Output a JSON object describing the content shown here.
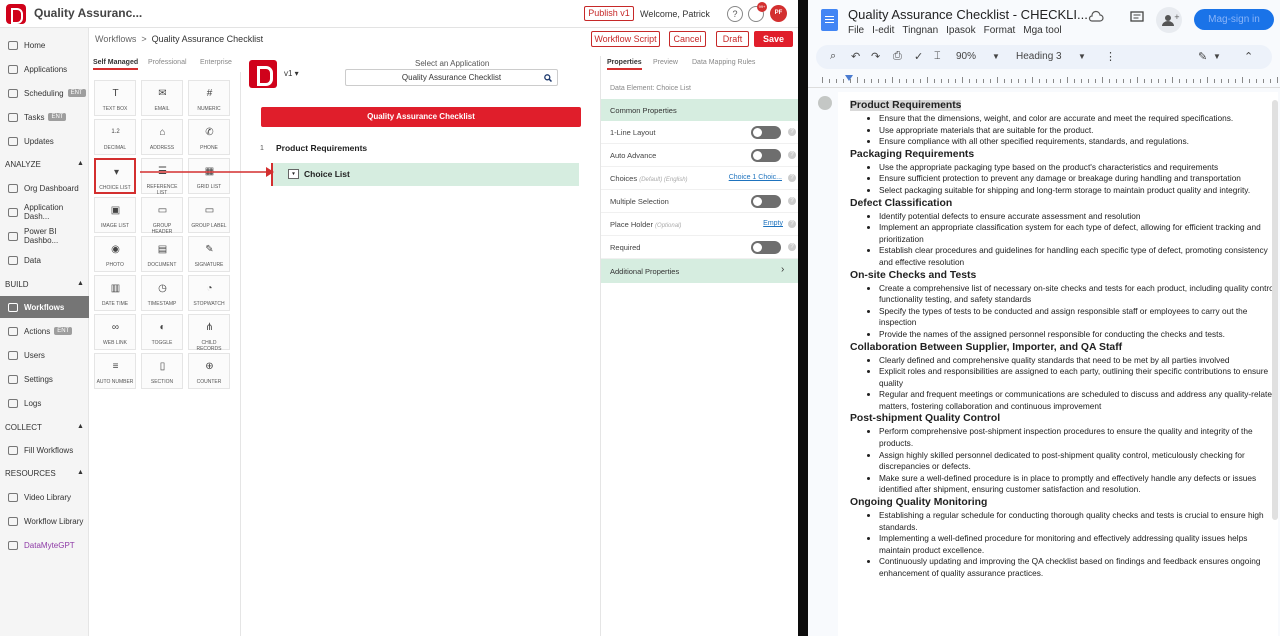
{
  "left": {
    "app_title": "Quality Assuranc...",
    "publish_label": "Publish v1",
    "welcome": "Welcome, Patrick",
    "help_icon": "?",
    "notif_count": "99+",
    "avatar_initials": "PF",
    "breadcrumb": {
      "root": "Workflows",
      "sep": ">",
      "current": "Quality Assurance Checklist"
    },
    "buttons": {
      "workflow_script": "Workflow Script",
      "cancel": "Cancel",
      "draft": "Draft",
      "save": "Save"
    },
    "accent_color": "#d32f2f",
    "sidebar": {
      "items": [
        {
          "label": "Home"
        },
        {
          "label": "Applications"
        },
        {
          "label": "Scheduling",
          "badge": "ENT"
        },
        {
          "label": "Tasks",
          "badge": "ENT"
        },
        {
          "label": "Updates"
        }
      ],
      "analyze_head": "ANALYZE",
      "analyze_items": [
        {
          "label": "Org Dashboard"
        },
        {
          "label": "Application Dash..."
        },
        {
          "label": "Power BI Dashbo..."
        },
        {
          "label": "Data"
        }
      ],
      "build_head": "BUILD",
      "build_items": [
        {
          "label": "Workflows"
        },
        {
          "label": "Actions",
          "badge": "ENT"
        },
        {
          "label": "Users"
        },
        {
          "label": "Settings"
        },
        {
          "label": "Logs"
        }
      ],
      "collect_head": "COLLECT",
      "collect_items": [
        {
          "label": "Fill Workflows"
        }
      ],
      "resources_head": "RESOURCES",
      "resources_items": [
        {
          "label": "Video Library"
        },
        {
          "label": "Workflow Library"
        },
        {
          "label": "DataMyteGPT"
        }
      ]
    },
    "palette_tabs": [
      "Self Managed",
      "Professional",
      "Enterprise"
    ],
    "palette": [
      {
        "label": "TEXT BOX",
        "icon": "T"
      },
      {
        "label": "EMAIL",
        "icon": "✉"
      },
      {
        "label": "NUMERIC",
        "icon": "#"
      },
      {
        "label": "DECIMAL",
        "icon": "1.2"
      },
      {
        "label": "ADDRESS",
        "icon": "⌂"
      },
      {
        "label": "PHONE",
        "icon": "✆"
      },
      {
        "label": "CHOICE LIST",
        "icon": "▾"
      },
      {
        "label": "REFERENCE LIST",
        "icon": "☰"
      },
      {
        "label": "GRID LIST",
        "icon": "▦"
      },
      {
        "label": "IMAGE LIST",
        "icon": "▣"
      },
      {
        "label": "GROUP HEADER",
        "icon": "▭"
      },
      {
        "label": "GROUP LABEL",
        "icon": "▭"
      },
      {
        "label": "PHOTO",
        "icon": "◉"
      },
      {
        "label": "DOCUMENT",
        "icon": "▤"
      },
      {
        "label": "SIGNATURE",
        "icon": "✎"
      },
      {
        "label": "DATE TIME",
        "icon": "▥"
      },
      {
        "label": "TIMESTAMP",
        "icon": "◷"
      },
      {
        "label": "STOPWATCH",
        "icon": "◔"
      },
      {
        "label": "WEB LINK",
        "icon": "∞"
      },
      {
        "label": "TOGGLE",
        "icon": "◐"
      },
      {
        "label": "CHILD RECORDS",
        "icon": "⋔"
      },
      {
        "label": "AUTO NUMBER",
        "icon": "≡"
      },
      {
        "label": "SECTION",
        "icon": "▯"
      },
      {
        "label": "COUNTER",
        "icon": "⊕"
      }
    ],
    "canvas": {
      "version": "v1 ▾",
      "select_label": "Select an Application",
      "select_value": "Quality Assurance Checklist",
      "form_title": "Quality Assurance Checklist",
      "section_number": "1",
      "section_title": "Product Requirements",
      "field_label": "Choice List"
    },
    "properties": {
      "tabs": [
        "Properties",
        "Preview",
        "Data Mapping Rules"
      ],
      "data_element": "Data Element: Choice List",
      "common_header": "Common Properties",
      "rows": [
        {
          "label": "1-Line Layout"
        },
        {
          "label": "Auto Advance"
        },
        {
          "label": "Choices",
          "hint": "(Default) (English)",
          "link": "Choice 1 Choic..."
        },
        {
          "label": "Multiple Selection"
        },
        {
          "label": "Place Holder",
          "hint": "(Optional)",
          "link": "Empty"
        },
        {
          "label": "Required"
        }
      ],
      "additional": "Additional Properties"
    }
  },
  "right": {
    "doc_title": "Quality Assurance Checklist - CHECKLI...",
    "menus": [
      "File",
      "I-edit",
      "Tingnan",
      "Ipasok",
      "Format",
      "Mga tool"
    ],
    "signin": "Mag-sign in",
    "zoom": "90%",
    "style": "Heading 3",
    "sections": [
      {
        "title": "Product Requirements",
        "items": [
          "Ensure that the dimensions, weight, and color are accurate and meet the required specifications.",
          "Use appropriate materials that are suitable for the product.",
          "Ensure compliance with all other specified requirements, standards, and regulations."
        ]
      },
      {
        "title": "Packaging Requirements",
        "items": [
          "Use the appropriate packaging type based on the product's characteristics and requirements",
          "Ensure sufficient protection to prevent any damage or breakage during handling and transportation",
          "Select packaging suitable for shipping and long-term storage to maintain product quality and integrity."
        ]
      },
      {
        "title": "Defect Classification",
        "items": [
          "Identify potential defects to ensure accurate assessment and resolution",
          "Implement an appropriate classification system for each type of defect, allowing for efficient tracking and prioritization",
          "Establish clear procedures and guidelines for handling each specific type of defect, promoting consistency and effective resolution"
        ]
      },
      {
        "title": "On-site Checks and Tests",
        "items": [
          "Create a comprehensive list of necessary on-site checks and tests for each product, including quality control, functionality testing, and safety standards",
          "Specify the types of tests to be conducted and assign responsible staff or employees to carry out the inspection",
          "Provide the names of the assigned personnel responsible for conducting the checks and tests."
        ]
      },
      {
        "title": "Collaboration Between Supplier, Importer, and QA Staff",
        "items": [
          "Clearly defined and comprehensive quality standards that need to be met by all parties involved",
          "Explicit roles and responsibilities are assigned to each party, outlining their specific contributions to ensure quality",
          "Regular and frequent meetings or communications are scheduled to discuss and address any quality-related matters, fostering collaboration and continuous improvement"
        ]
      },
      {
        "title": "Post-shipment Quality Control",
        "items": [
          "Perform comprehensive post-shipment inspection procedures to ensure the quality and integrity of the products.",
          "Assign highly skilled personnel dedicated to post-shipment quality control, meticulously checking for discrepancies or defects.",
          "Make sure a well-defined procedure is in place to promptly and effectively handle any defects or issues identified after shipment, ensuring customer satisfaction and resolution."
        ]
      },
      {
        "title": "Ongoing Quality Monitoring",
        "items": [
          "Establishing a regular schedule for conducting thorough quality checks and tests is crucial to ensure high standards.",
          "Implementing a well-defined procedure for monitoring and effectively addressing quality issues helps maintain product excellence.",
          "Continuously updating and improving the QA checklist based on findings and feedback ensures ongoing enhancement of quality assurance practices."
        ]
      }
    ]
  }
}
